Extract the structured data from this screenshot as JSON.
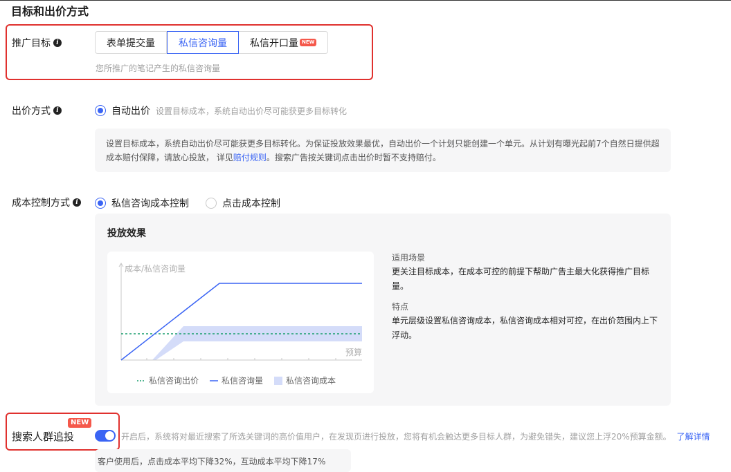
{
  "section_title": "目标和出价方式",
  "goal": {
    "label": "推广目标",
    "options": [
      {
        "label": "表单提交量",
        "active": false
      },
      {
        "label": "私信咨询量",
        "active": true
      },
      {
        "label": "私信开口量",
        "active": false,
        "badge": "NEW"
      }
    ],
    "hint": "您所推广的笔记产生的私信咨询量"
  },
  "bid": {
    "label": "出价方式",
    "option": "自动出价",
    "option_hint": "设置目标成本，系统自动出价尽可能获更多目标转化",
    "desc_prefix": "设置目标成本，系统自动出价尽可能获更多目标转化。为保证投放效果最优，自动出价一个计划只能创建一个单元。从计划有曝光起前7个自然日提供超成本赔付保障，请放心投放， 详见",
    "desc_link": "赔付规则",
    "desc_suffix": "。搜索广告按关键词点击出价时暂不支持赔付。"
  },
  "cost_control": {
    "label": "成本控制方式",
    "options": [
      {
        "label": "私信咨询成本控制",
        "checked": true
      },
      {
        "label": "点击成本控制",
        "checked": false
      }
    ],
    "effect_title": "投放效果",
    "scene_title": "适用场景",
    "scene_text": "更关注目标成本，在成本可控的前提下帮助广告主最大化获得推广目标量。",
    "feature_title": "特点",
    "feature_text": "单元层级设置私信咨询成本，私信咨询成本相对可控，在出价范围内上下浮动。"
  },
  "chart": {
    "ylabel": "成本/私信咨询量",
    "xlabel": "预算",
    "legend": [
      "私信咨询出价",
      "私信咨询量",
      "私信咨询成本"
    ],
    "colors": {
      "bid": "#1a9e6e",
      "volume": "#3a64f4",
      "cost": "#d4dcf9"
    }
  },
  "retarget": {
    "label": "搜索人群追投",
    "badge": "NEW",
    "enabled": true,
    "text": "开启后，系统将对最近搜索了所选关键词的高价值用户，在发现页进行投放，您将有机会触达更多目标人群，为避免错失，建议您上浮20%预算金额。",
    "link": "了解详情",
    "stat": "客户使用后，点击成本平均下降32%，互动成本平均下降17%"
  }
}
